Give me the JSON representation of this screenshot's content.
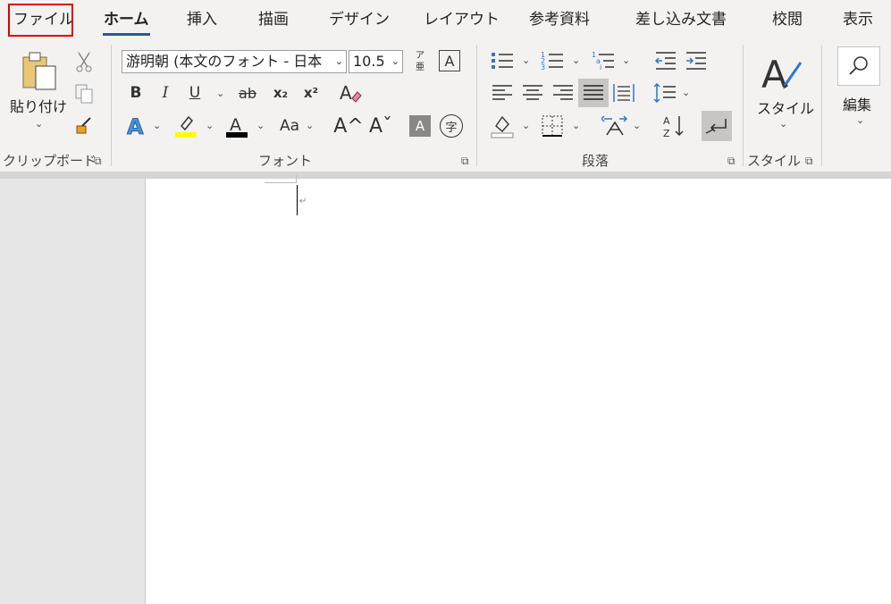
{
  "tabs": [
    "ファイル",
    "ホーム",
    "挿入",
    "描画",
    "デザイン",
    "レイアウト",
    "参考資料",
    "差し込み文書",
    "校閲",
    "表示"
  ],
  "clipboard": {
    "paste_label": "貼り付け",
    "group_label": "クリップボード"
  },
  "font": {
    "font_name": "游明朝 (本文のフォント - 日本",
    "font_size": "10.5",
    "group_label": "フォント",
    "bold": "B",
    "italic": "I",
    "underline": "U",
    "strike": "ab",
    "sub": "x₂",
    "sup": "x²",
    "grow": "A^",
    "shrink": "Aˇ",
    "case": "Aa",
    "phonetic_top": "ア",
    "phonetic_bottom": "亜",
    "enclose": "字"
  },
  "paragraph": {
    "group_label": "段落"
  },
  "styles": {
    "label": "スタイル",
    "group_label": "スタイル"
  },
  "editing": {
    "label": "編集"
  },
  "document": {
    "para_mark": "↵"
  },
  "colors": {
    "accent": "#2b579a",
    "highlight": "#ffff00",
    "font_color": "#000000",
    "file_box": "#e00000"
  }
}
